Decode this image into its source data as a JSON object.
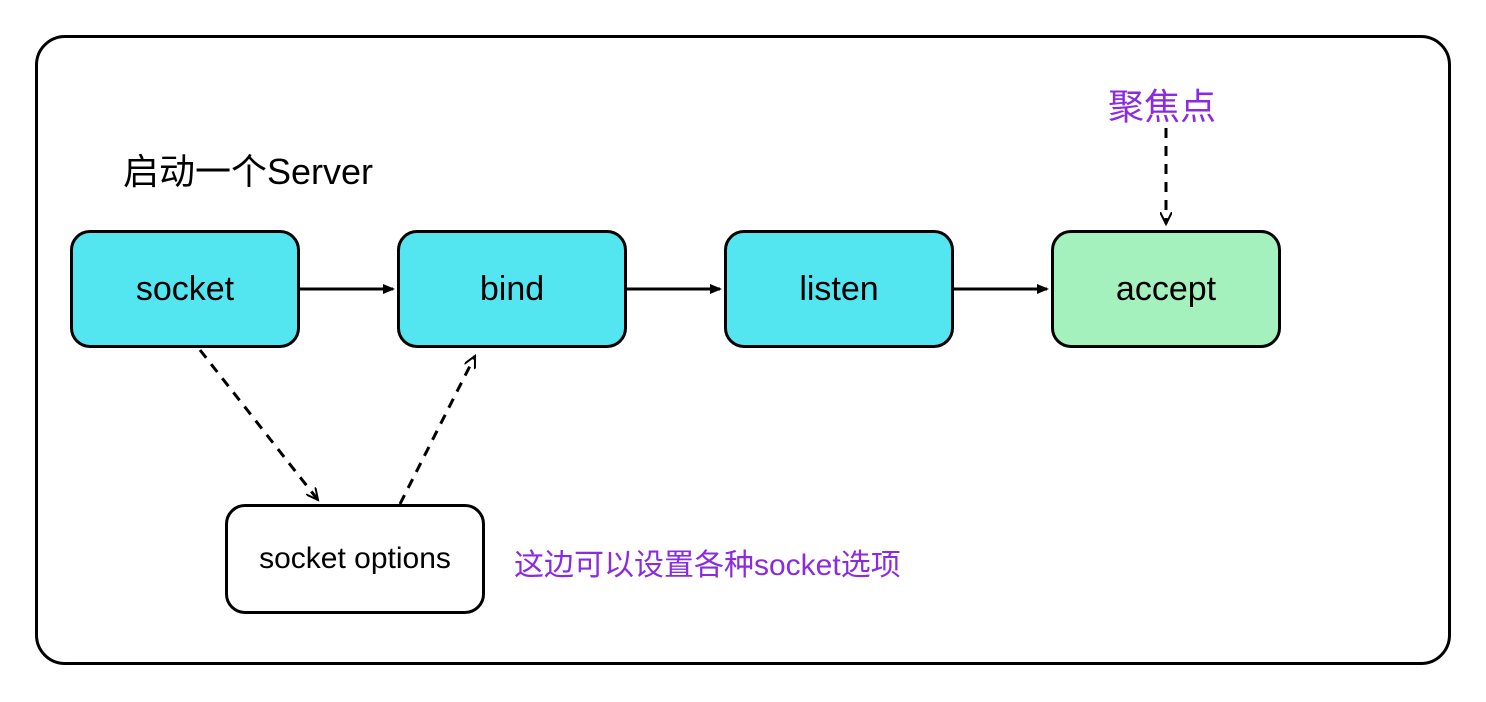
{
  "container": {
    "title": "启动一个Server"
  },
  "nodes": {
    "socket": {
      "label": "socket"
    },
    "bind": {
      "label": "bind"
    },
    "listen": {
      "label": "listen"
    },
    "accept": {
      "label": "accept"
    },
    "options": {
      "label": "socket options"
    }
  },
  "annotations": {
    "options_note": "这边可以设置各种socket选项",
    "focus_label": "聚焦点"
  },
  "colors": {
    "cyan": "#54e6f0",
    "green": "#a4f1be",
    "purple": "#8a2be2",
    "black": "#000000"
  }
}
